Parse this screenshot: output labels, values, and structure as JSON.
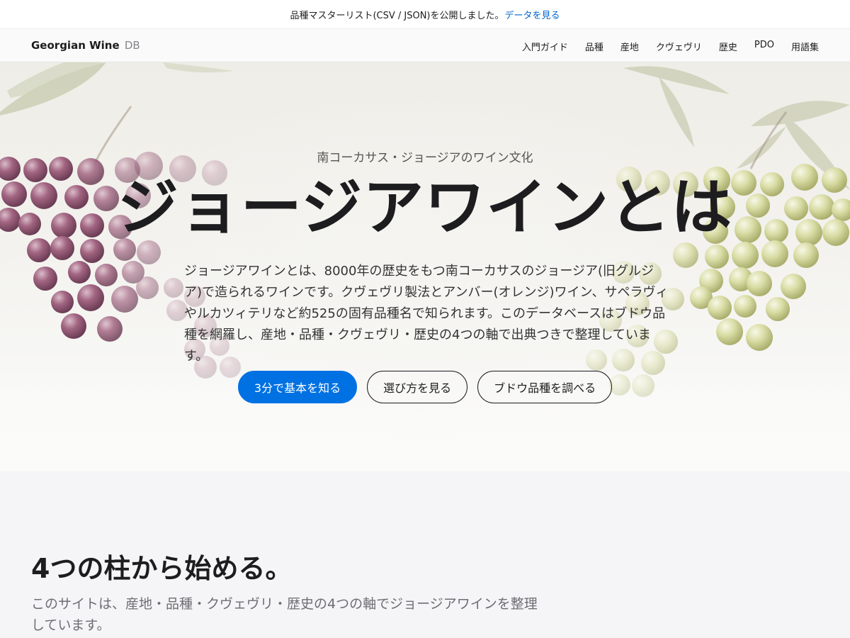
{
  "announcement": {
    "text": "品種マスターリスト(CSV / JSON)を公開しました。",
    "link": "データを見る"
  },
  "nav": {
    "brand": "Georgian Wine",
    "brand_suffix": "DB",
    "links": [
      "入門ガイド",
      "品種",
      "産地",
      "クヴェヴリ",
      "歴史",
      "PDO",
      "用語集"
    ]
  },
  "hero": {
    "eyebrow": "南コーカサス・ジョージアのワイン文化",
    "title": "ジョージアワインとは",
    "description": "ジョージアワインとは、8000年の歴史をもつ南コーカサスのジョージア(旧グルジア)で造られるワインです。クヴェヴリ製法とアンバー(オレンジ)ワイン、サペラヴィやルカツィテリなど約525の固有品種名で知られます。このデータベースはブドウ品種を網羅し、産地・品種・クヴェヴリ・歴史の4つの軸で出典つきで整理しています。",
    "buttons": {
      "primary": "3分で基本を知る",
      "secondary_1": "選び方を見る",
      "secondary_2": "ブドウ品種を調べる"
    }
  },
  "section": {
    "title": "4つの柱から始める。",
    "description": "このサイトは、産地・品種・クヴェヴリ・歴史の4つの軸でジョージアワインを整理しています。"
  },
  "colors": {
    "accent": "#0071e3",
    "link": "#0066cc",
    "text": "#1d1d1f",
    "muted": "#6e6e73",
    "grape_red": "#7a3d5c",
    "grape_white": "#c9cf8a",
    "leaf": "#b9bd96"
  }
}
